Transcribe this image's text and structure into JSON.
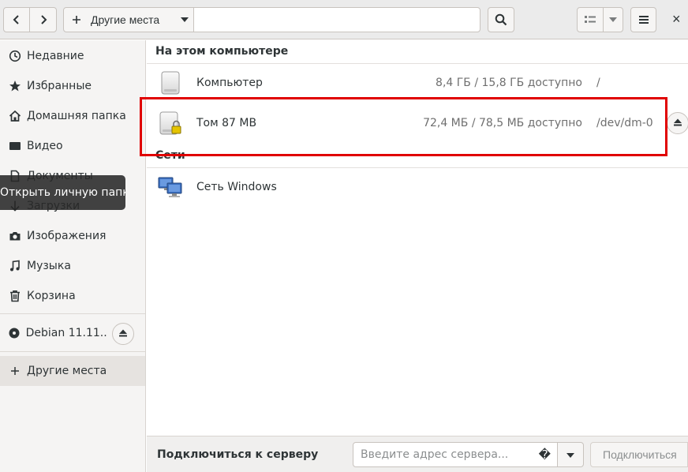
{
  "header": {
    "location_label": "Другие места",
    "close_symbol": "×"
  },
  "sidebar": {
    "items": [
      {
        "label": "Недавние",
        "icon": "clock-icon"
      },
      {
        "label": "Избранные",
        "icon": "star-icon"
      },
      {
        "label": "Домашняя папка",
        "icon": "home-icon"
      },
      {
        "label": "Видео",
        "icon": "video-icon"
      },
      {
        "label": "Документы",
        "icon": "document-icon"
      },
      {
        "label": "Загрузки",
        "icon": "download-icon"
      },
      {
        "label": "Изображения",
        "icon": "camera-icon"
      },
      {
        "label": "Музыка",
        "icon": "music-icon"
      },
      {
        "label": "Корзина",
        "icon": "trash-icon"
      }
    ],
    "device": {
      "label": "Debian 11.11....",
      "icon": "disc-icon"
    },
    "other_places": {
      "label": "Другие места",
      "icon": "plus-icon"
    },
    "tooltip": "Открыть личную папку"
  },
  "main": {
    "on_this_computer": {
      "title": "На этом компьютере",
      "rows": [
        {
          "name": "Компьютер",
          "space": "8,4 ГБ / 15,8 ГБ доступно",
          "mount": "/"
        },
        {
          "name": "Том 87 MB",
          "space": "72,4 МБ / 78,5 МБ доступно",
          "mount": "/dev/dm-0"
        }
      ]
    },
    "networks": {
      "title": "Сети",
      "rows": [
        {
          "name": "Сеть Windows"
        }
      ]
    }
  },
  "actionbar": {
    "label": "Подключиться к серверу",
    "placeholder": "Введите адрес сервера...",
    "help_symbol": "�",
    "connect_label": "Подключиться"
  },
  "colors": {
    "highlight": "#e00000",
    "accent": "#3584e4"
  }
}
